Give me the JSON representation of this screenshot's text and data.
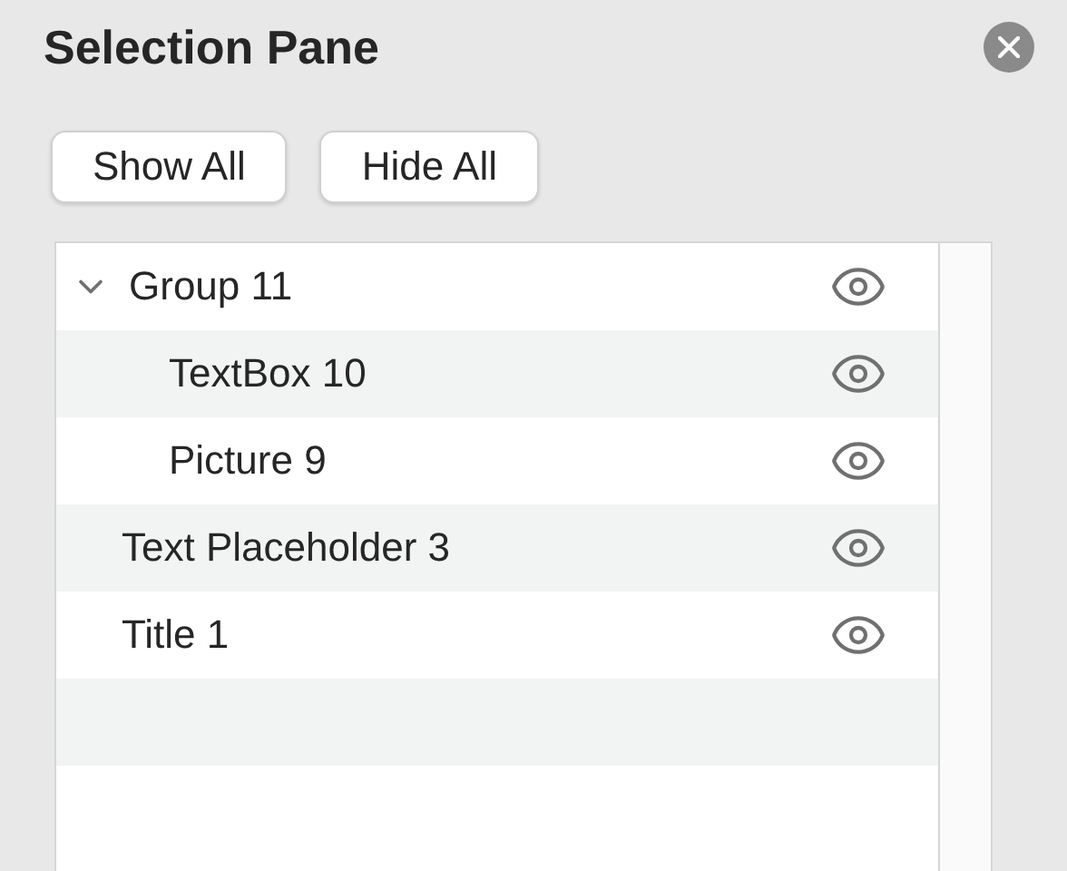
{
  "pane": {
    "title": "Selection Pane"
  },
  "buttons": [
    "Show All",
    "Hide All"
  ],
  "items": [
    {
      "label": "Group 11",
      "visible": true,
      "expanded": true,
      "children": [
        {
          "label": "TextBox 10",
          "visible": true
        },
        {
          "label": "Picture 9",
          "visible": true
        }
      ]
    },
    {
      "label": "Text Placeholder 3",
      "visible": true
    },
    {
      "label": "Title 1",
      "visible": true
    }
  ]
}
